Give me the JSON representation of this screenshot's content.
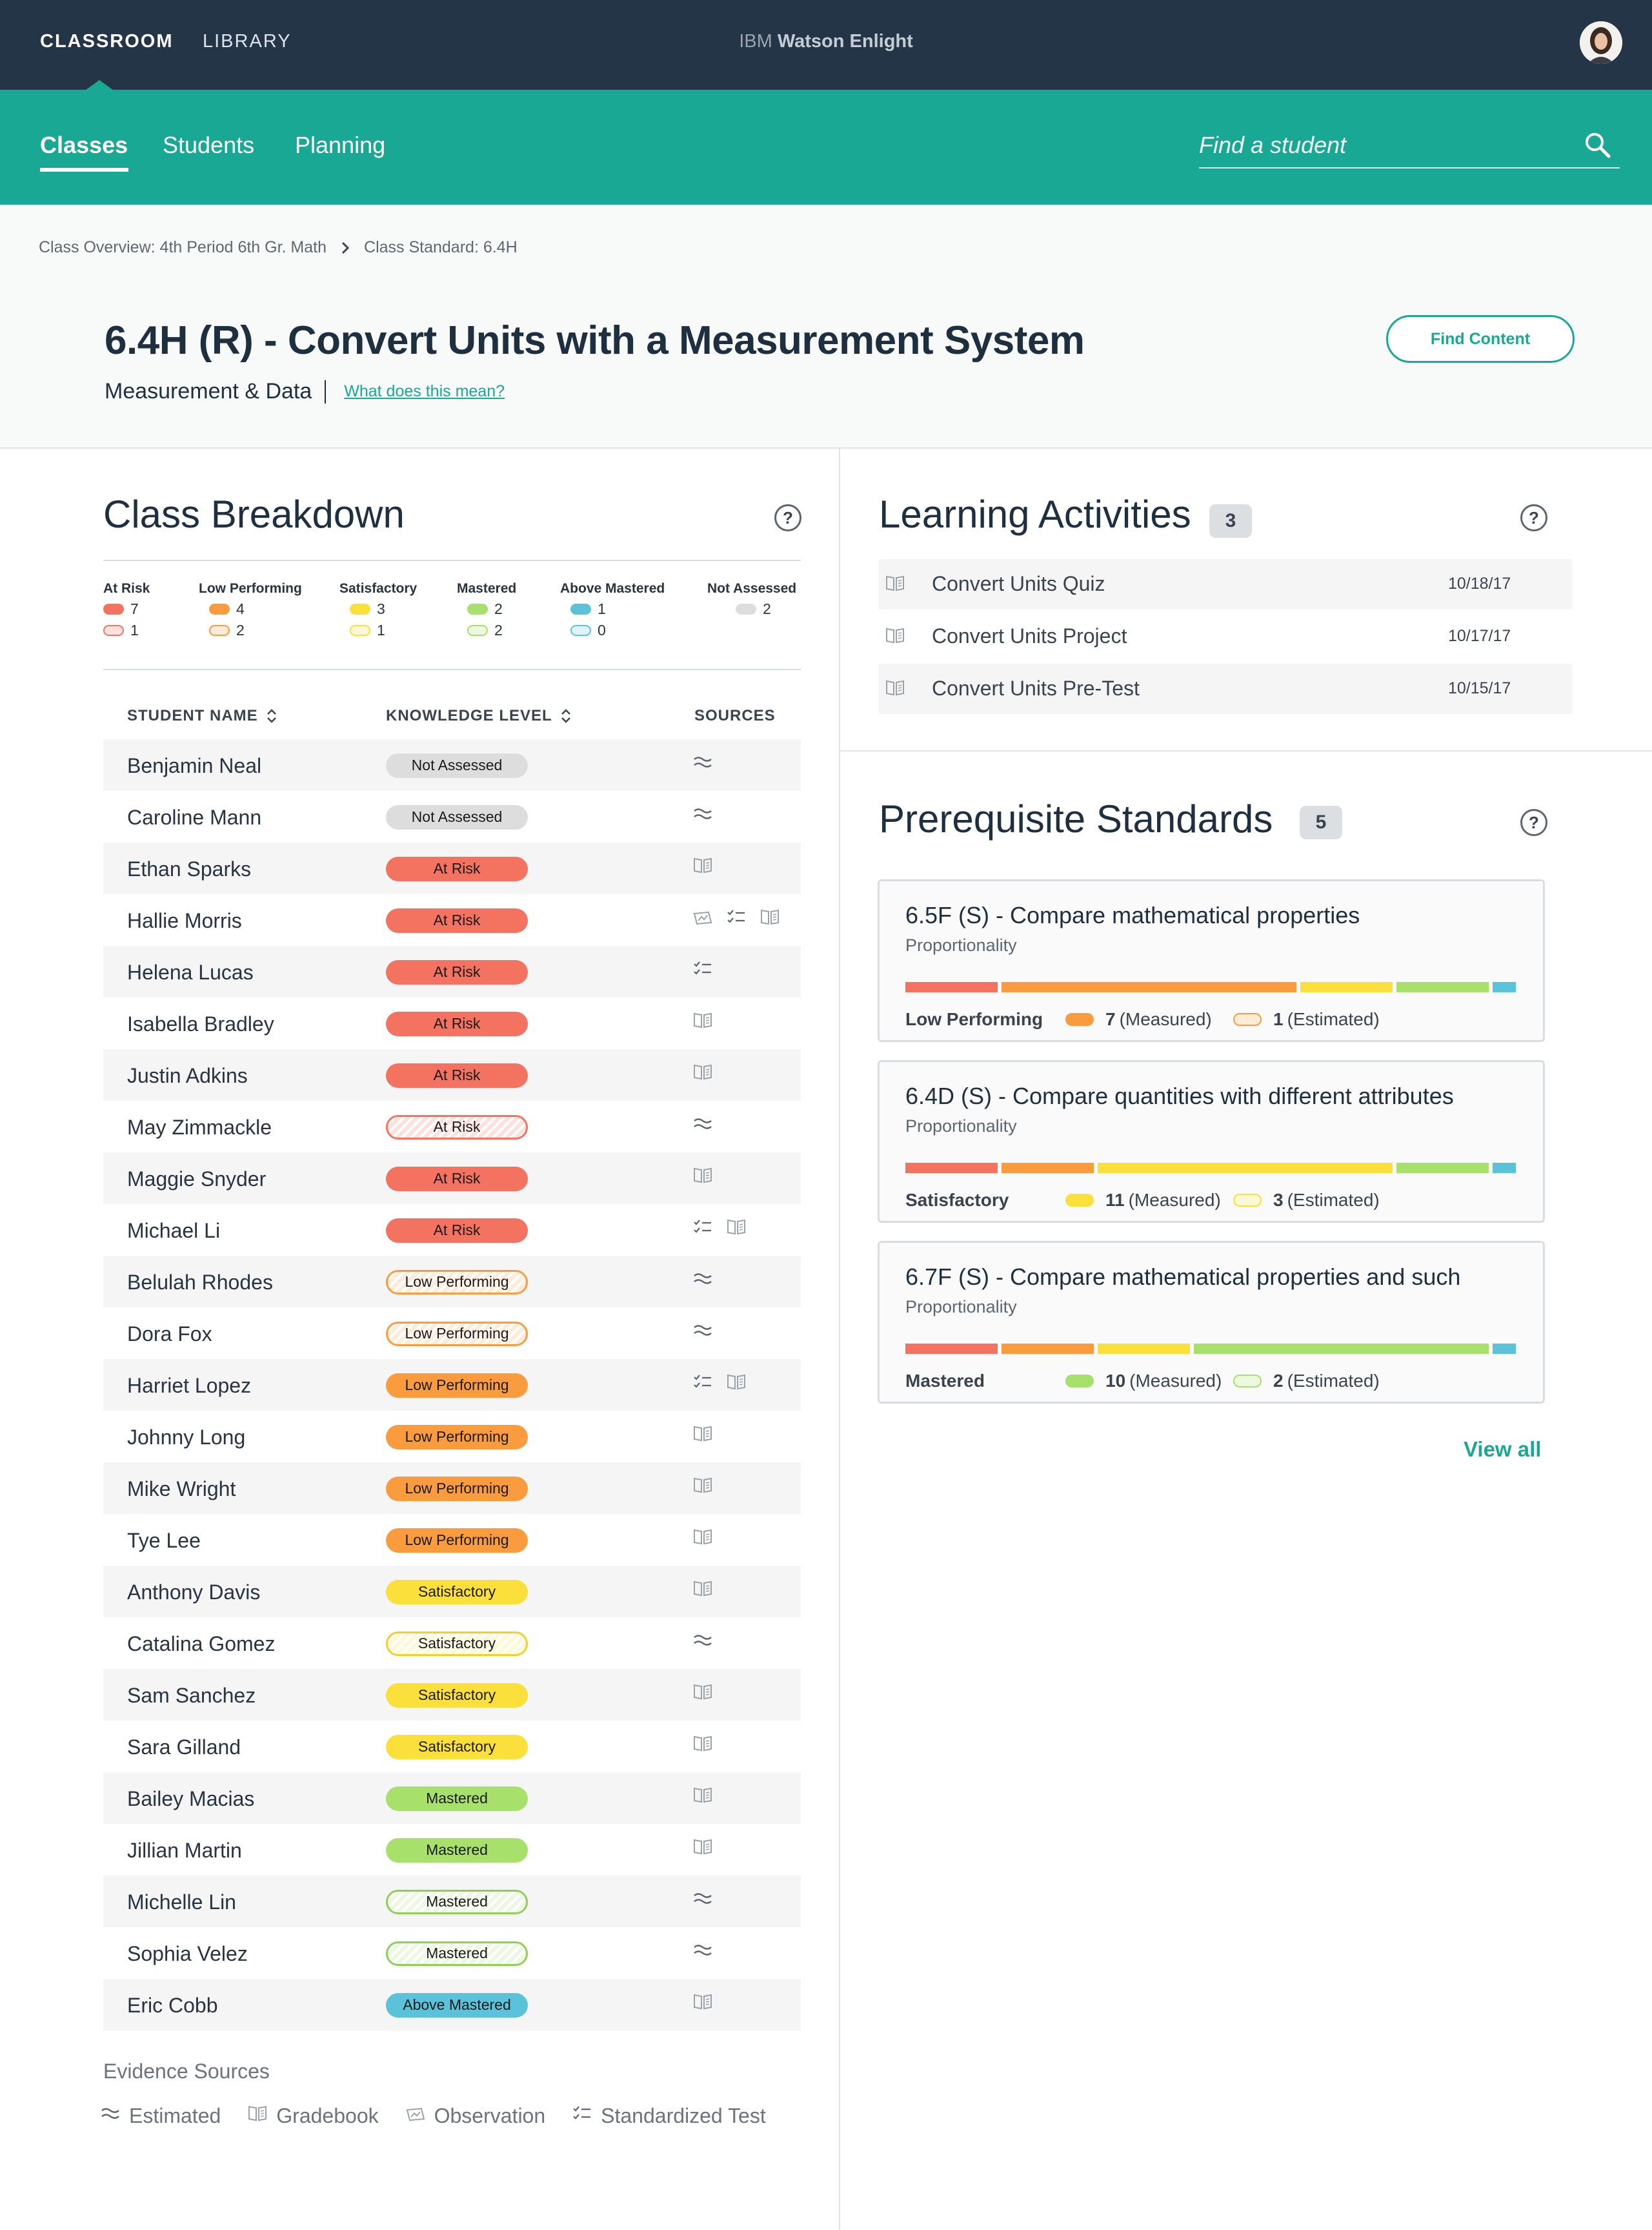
{
  "colors": {
    "nav": "#243548",
    "teal": "#19a894",
    "at_risk": "#f47260",
    "low_performing": "#fa9c3d",
    "satisfactory": "#fbe03c",
    "mastered": "#a7e16b",
    "above_mastered": "#5bc3d9",
    "not_assessed": "#dddddd"
  },
  "topnav": {
    "classroom": "CLASSROOM",
    "library": "LIBRARY",
    "brand_prefix": "IBM",
    "brand_name": "Watson Enlight"
  },
  "subnav": {
    "tabs": [
      "Classes",
      "Students",
      "Planning"
    ],
    "search_placeholder": "Find a student"
  },
  "breadcrumb": [
    "Class Overview: 4th Period 6th Gr. Math",
    "Class Standard: 6.4H"
  ],
  "header": {
    "title": "6.4H (R) - Convert Units with a Measurement System",
    "subtitle": "Measurement & Data",
    "link": "What does this mean?",
    "find_button": "Find Content"
  },
  "breakdown": {
    "title": "Class Breakdown",
    "legend": [
      {
        "label": "At Risk",
        "measured": "7",
        "estimated": "1",
        "color": "#f47260"
      },
      {
        "label": "Low Performing",
        "measured": "4",
        "estimated": "2",
        "color": "#fa9c3d"
      },
      {
        "label": "Satisfactory",
        "measured": "3",
        "estimated": "1",
        "color": "#fbe03c"
      },
      {
        "label": "Mastered",
        "measured": "2",
        "estimated": "2",
        "color": "#a7e16b"
      },
      {
        "label": "Above Mastered",
        "measured": "1",
        "estimated": "0",
        "color": "#5bc3d9"
      },
      {
        "label": "Not Assessed",
        "measured": "2",
        "estimated": "",
        "color": "#dddddd"
      }
    ],
    "columns": {
      "name": "STUDENT NAME",
      "level": "KNOWLEDGE LEVEL",
      "sources": "SOURCES"
    },
    "students": [
      {
        "name": "Benjamin Neal",
        "level": "Not Assessed",
        "kind": "na",
        "est": false,
        "sources": [
          "estimated"
        ]
      },
      {
        "name": "Caroline Mann",
        "level": "Not Assessed",
        "kind": "na",
        "est": false,
        "sources": [
          "estimated"
        ]
      },
      {
        "name": "Ethan Sparks",
        "level": "At Risk",
        "kind": "ar",
        "est": false,
        "sources": [
          "gradebook"
        ]
      },
      {
        "name": "Hallie Morris",
        "level": "At Risk",
        "kind": "ar",
        "est": false,
        "sources": [
          "observation",
          "test",
          "gradebook"
        ]
      },
      {
        "name": "Helena Lucas",
        "level": "At Risk",
        "kind": "ar",
        "est": false,
        "sources": [
          "test"
        ]
      },
      {
        "name": "Isabella Bradley",
        "level": "At Risk",
        "kind": "ar",
        "est": false,
        "sources": [
          "gradebook"
        ]
      },
      {
        "name": "Justin Adkins",
        "level": "At Risk",
        "kind": "ar",
        "est": false,
        "sources": [
          "gradebook"
        ]
      },
      {
        "name": "May Zimmackle",
        "level": "At Risk",
        "kind": "ar",
        "est": true,
        "sources": [
          "estimated"
        ]
      },
      {
        "name": "Maggie Snyder",
        "level": "At Risk",
        "kind": "ar",
        "est": false,
        "sources": [
          "gradebook"
        ]
      },
      {
        "name": "Michael Li",
        "level": "At Risk",
        "kind": "ar",
        "est": false,
        "sources": [
          "test",
          "gradebook"
        ]
      },
      {
        "name": "Belulah Rhodes",
        "level": "Low Performing",
        "kind": "lp",
        "est": true,
        "sources": [
          "estimated"
        ]
      },
      {
        "name": "Dora Fox",
        "level": "Low Performing",
        "kind": "lp",
        "est": true,
        "sources": [
          "estimated"
        ]
      },
      {
        "name": "Harriet Lopez",
        "level": "Low Performing",
        "kind": "lp",
        "est": false,
        "sources": [
          "test",
          "gradebook"
        ]
      },
      {
        "name": "Johnny Long",
        "level": "Low Performing",
        "kind": "lp",
        "est": false,
        "sources": [
          "gradebook"
        ]
      },
      {
        "name": "Mike Wright",
        "level": "Low Performing",
        "kind": "lp",
        "est": false,
        "sources": [
          "gradebook"
        ]
      },
      {
        "name": "Tye Lee",
        "level": "Low Performing",
        "kind": "lp",
        "est": false,
        "sources": [
          "gradebook"
        ]
      },
      {
        "name": "Anthony Davis",
        "level": "Satisfactory",
        "kind": "sa",
        "est": false,
        "sources": [
          "gradebook"
        ]
      },
      {
        "name": "Catalina Gomez",
        "level": "Satisfactory",
        "kind": "sa",
        "est": true,
        "sources": [
          "estimated"
        ]
      },
      {
        "name": "Sam Sanchez",
        "level": "Satisfactory",
        "kind": "sa",
        "est": false,
        "sources": [
          "gradebook"
        ]
      },
      {
        "name": "Sara Gilland",
        "level": "Satisfactory",
        "kind": "sa",
        "est": false,
        "sources": [
          "gradebook"
        ]
      },
      {
        "name": "Bailey Macias",
        "level": "Mastered",
        "kind": "ma",
        "est": false,
        "sources": [
          "gradebook"
        ]
      },
      {
        "name": "Jillian Martin",
        "level": "Mastered",
        "kind": "ma",
        "est": false,
        "sources": [
          "gradebook"
        ]
      },
      {
        "name": "Michelle Lin",
        "level": "Mastered",
        "kind": "ma",
        "est": true,
        "sources": [
          "estimated"
        ]
      },
      {
        "name": "Sophia Velez",
        "level": "Mastered",
        "kind": "ma",
        "est": true,
        "sources": [
          "estimated"
        ]
      },
      {
        "name": "Eric Cobb",
        "level": "Above Mastered",
        "kind": "am",
        "est": false,
        "sources": [
          "gradebook"
        ]
      }
    ],
    "evidence_title": "Evidence Sources",
    "evidence": [
      {
        "key": "estimated",
        "label": "Estimated"
      },
      {
        "key": "gradebook",
        "label": "Gradebook"
      },
      {
        "key": "observation",
        "label": "Observation"
      },
      {
        "key": "test",
        "label": "Standardized Test"
      }
    ]
  },
  "activities": {
    "title": "Learning Activities",
    "count": "3",
    "items": [
      {
        "name": "Convert Units Quiz",
        "date": "10/18/17"
      },
      {
        "name": "Convert Units Project",
        "date": "10/17/17"
      },
      {
        "name": "Convert Units Pre-Test",
        "date": "10/15/17"
      }
    ]
  },
  "prereq": {
    "title": "Prerequisite Standards",
    "count": "5",
    "view_all": "View all",
    "cards": [
      {
        "title": "6.5F (S)  - Compare mathematical properties",
        "sub": "Proportionality",
        "level": "Low Performing",
        "measured": "7",
        "measured_label": "(Measured)",
        "estimated": "1",
        "estimated_label": "(Estimated)",
        "color": "#fa9c3d",
        "focus": 1
      },
      {
        "title": "6.4D (S) - Compare quantities with different attributes",
        "sub": "Proportionality",
        "level": "Satisfactory",
        "measured": "11",
        "measured_label": "(Measured)",
        "estimated": "3",
        "estimated_label": "(Estimated)",
        "color": "#fbe03c",
        "focus": 2
      },
      {
        "title": "6.7F (S)  - Compare mathematical properties and such",
        "sub": "Proportionality",
        "level": "Mastered",
        "measured": "10",
        "measured_label": "(Measured)",
        "estimated": "2",
        "estimated_label": "(Estimated)",
        "color": "#a7e16b",
        "focus": 3
      }
    ]
  }
}
